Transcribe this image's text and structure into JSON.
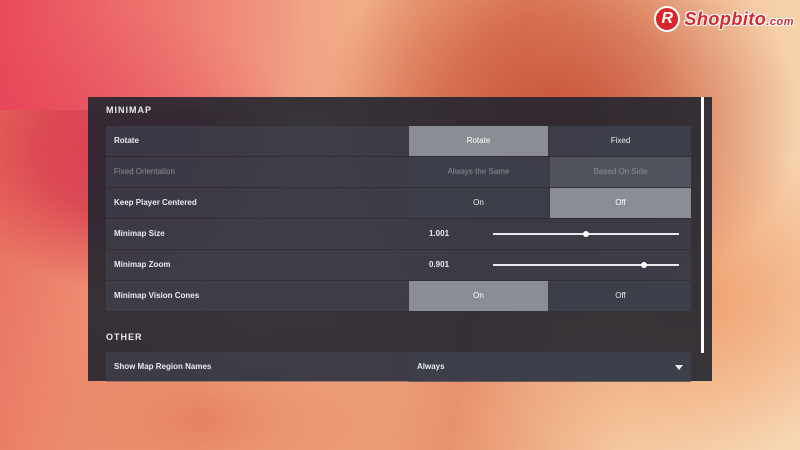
{
  "logo": {
    "badge": "R",
    "name": "Shopbito",
    "suffix": ".com"
  },
  "minimap": {
    "title": "MINIMAP",
    "rotate": {
      "label": "Rotate",
      "options": [
        "Rotate",
        "Fixed"
      ],
      "selected": "Rotate"
    },
    "fixed_orientation": {
      "label": "Fixed Orientation",
      "options": [
        "Always the Same",
        "Based On Side"
      ],
      "disabled": true
    },
    "keep_player_centered": {
      "label": "Keep Player Centered",
      "options": [
        "On",
        "Off"
      ],
      "selected": "Off"
    },
    "minimap_size": {
      "label": "Minimap Size",
      "value": "1.001",
      "fraction": 0.5
    },
    "minimap_zoom": {
      "label": "Minimap Zoom",
      "value": "0.901",
      "fraction": 0.81
    },
    "vision_cones": {
      "label": "Minimap Vision Cones",
      "options": [
        "On",
        "Off"
      ],
      "selected": "On"
    }
  },
  "other": {
    "title": "OTHER",
    "show_region_names": {
      "label": "Show Map Region Names",
      "value": "Always"
    }
  },
  "colors": {
    "panel": "#222630",
    "selected_option": "#8a8e94",
    "logo_red": "#d8262c"
  }
}
